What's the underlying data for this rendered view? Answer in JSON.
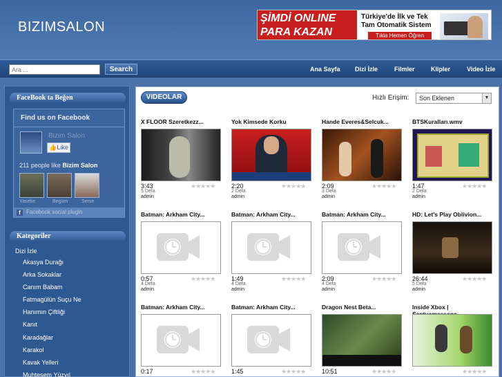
{
  "site": {
    "title": "BIZIMSALON"
  },
  "banner": {
    "left_text": "ŞİMDİ ONLINE PARA KAZAN",
    "middle_text": "Türkiye'de İlk ve Tek Tam Otomatik Sistem",
    "cta": "Tıkla Hemen Öğren"
  },
  "search": {
    "placeholder": "Ara ...",
    "button_label": "Search"
  },
  "nav": [
    "Ana Sayfa",
    "Dizi İzle",
    "Filmler",
    "Klipler",
    "Video İzle"
  ],
  "sidebar": {
    "facebook_title": "FaceBook ta Beğen",
    "fb_box_title": "Find us on Facebook",
    "fb_page_name": "Bizim Salon",
    "fb_like": "Like",
    "fb_count": "211 people like",
    "fb_count_name": "Bizim Salon",
    "fb_faces": [
      "Yasebe",
      "Begüm",
      "Serse"
    ],
    "fb_footer": "Facebook social plugin",
    "categories_title": "Kategoriler",
    "category_root": "Dizi İzle",
    "categories": [
      "Akasya Durağı",
      "Arka Sokaklar",
      "Canım Babam",
      "Fatmagülün Suçu Ne",
      "Hanımın Çiftliği",
      "Kanıt",
      "Karadağlar",
      "Karakol",
      "Kavak Yelleri",
      "Muhteşem Yüzyıl"
    ]
  },
  "content": {
    "tab": "VIDEOLAR",
    "quick_label": "Hızlı Erişim:",
    "quick_selected": "Son Eklenen",
    "videos": [
      {
        "title": "X FLOOR Szeretkezz...",
        "duration": "3:43",
        "views": "5 Defa",
        "author": "admin",
        "thumb": "xfloor"
      },
      {
        "title": "Yok Kimsede Korku",
        "duration": "2:20",
        "views": "2 Defa",
        "author": "admin",
        "thumb": "news"
      },
      {
        "title": "Hande Everes&Selcuk...",
        "duration": "2:09",
        "views": "3 Defa",
        "author": "admin",
        "thumb": "stage"
      },
      {
        "title": "BTSKuralları.wmv",
        "duration": "1:47",
        "views": "2 Defa",
        "author": "admin",
        "thumb": "bts"
      },
      {
        "title": "Batman: Arkham City...",
        "duration": "0:57",
        "views": "4 Defa",
        "author": "admin",
        "thumb": "placeholder"
      },
      {
        "title": "Batman: Arkham City...",
        "duration": "1:49",
        "views": "4 Defa",
        "author": "admin",
        "thumb": "placeholder"
      },
      {
        "title": "Batman: Arkham City...",
        "duration": "2:09",
        "views": "4 Defa",
        "author": "admin",
        "thumb": "placeholder"
      },
      {
        "title": "HD: Let's Play Oblivion...",
        "duration": "26:44",
        "views": "5 Defa",
        "author": "admin",
        "thumb": "oblivion"
      },
      {
        "title": "Batman: Arkham City...",
        "duration": "0:17",
        "views": "",
        "author": "",
        "thumb": "placeholder"
      },
      {
        "title": "Batman: Arkham City...",
        "duration": "1:45",
        "views": "",
        "author": "",
        "thumb": "placeholder"
      },
      {
        "title": "Dragon Nest Beta...",
        "duration": "10:51",
        "views": "",
        "author": "",
        "thumb": "dragon"
      },
      {
        "title": "Inside Xbox | Sentuamessage...",
        "duration": "",
        "views": "",
        "author": "",
        "thumb": "xbox"
      }
    ]
  },
  "colors": {
    "page_bg": "#4a72a8",
    "nav_bg": "#2f5a95",
    "accent_red": "#c81e1e"
  }
}
